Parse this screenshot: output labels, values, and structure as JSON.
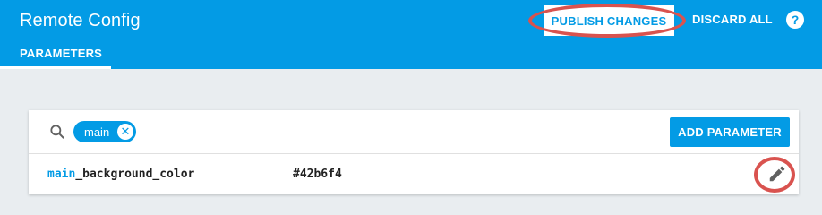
{
  "app": {
    "title": "Remote Config"
  },
  "header": {
    "publish_label": "PUBLISH CHANGES",
    "discard_label": "DISCARD ALL",
    "help_glyph": "?"
  },
  "tabs": [
    {
      "label": "PARAMETERS"
    }
  ],
  "search": {
    "chip_label": "main",
    "chip_close_glyph": "✕"
  },
  "toolbar": {
    "add_label": "ADD PARAMETER"
  },
  "parameters": [
    {
      "key_match": "main",
      "key_rest": "_background_color",
      "value": "#42b6f4"
    }
  ],
  "colors": {
    "accent": "#039be5",
    "highlight_ring": "#d9534f",
    "background": "#e9edf0"
  },
  "icons": {
    "search": "search-icon",
    "help": "help-icon",
    "close": "close-icon",
    "edit": "pencil-icon"
  }
}
